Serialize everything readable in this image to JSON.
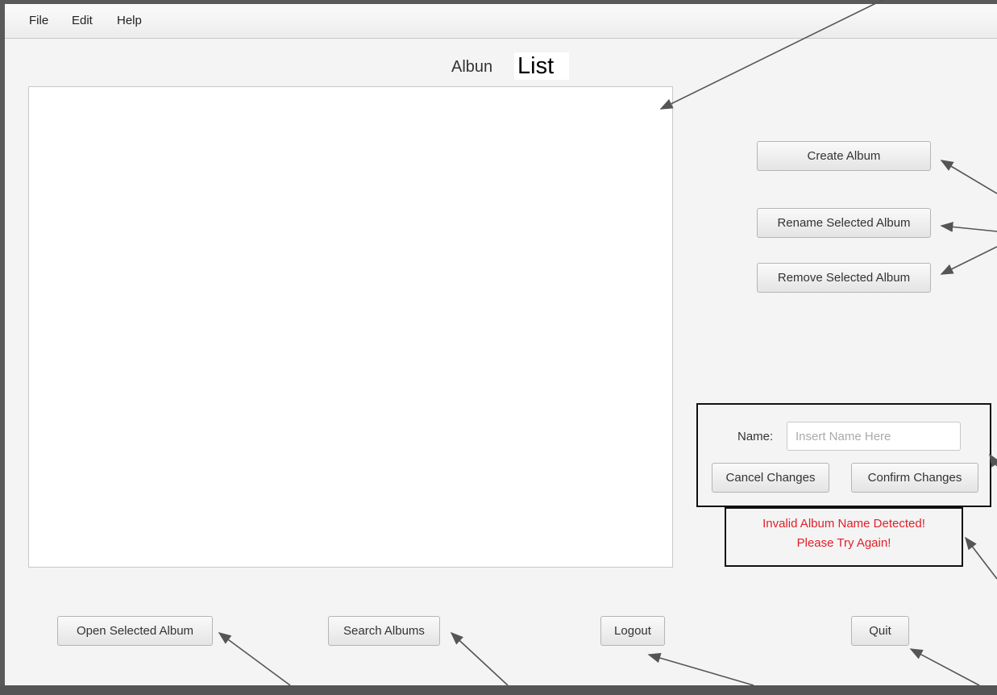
{
  "menu": {
    "file": "File",
    "edit": "Edit",
    "help": "Help"
  },
  "title": {
    "part1": "Albun",
    "part2": "List"
  },
  "side_buttons": {
    "create": "Create Album",
    "rename": "Rename Selected Album",
    "remove": "Remove Selected Album"
  },
  "name_form": {
    "label": "Name:",
    "placeholder": "Insert Name Here",
    "cancel": "Cancel Changes",
    "confirm": "Confirm Changes"
  },
  "error": {
    "line1": "Invalid Album Name Detected!",
    "line2": "Please Try Again!",
    "color": "#e0202a"
  },
  "bottom_buttons": {
    "open": "Open Selected Album",
    "search": "Search Albums",
    "logout": "Logout",
    "quit": "Quit"
  }
}
